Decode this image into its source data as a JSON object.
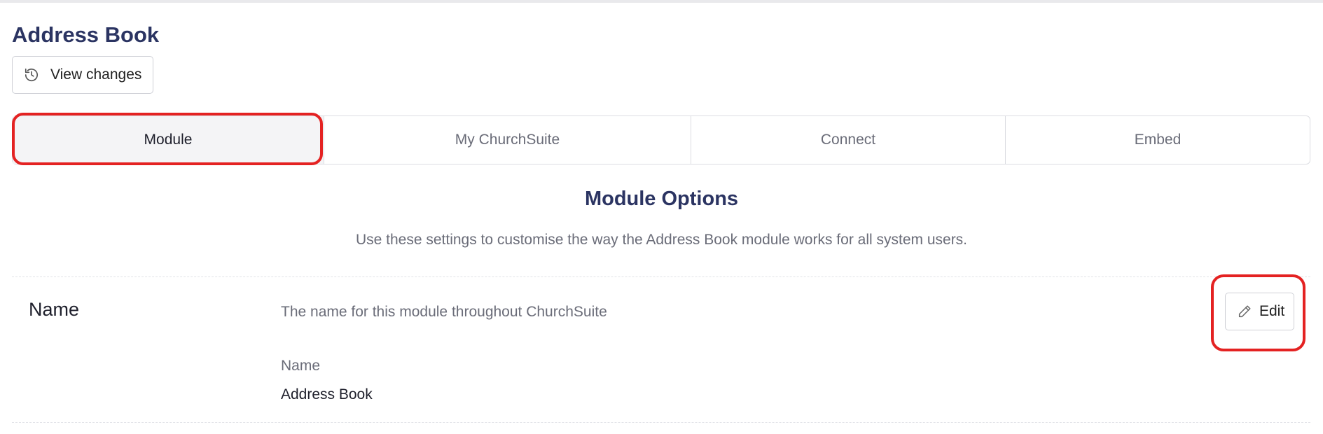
{
  "page": {
    "title": "Address Book"
  },
  "toolbar": {
    "view_changes_label": "View changes",
    "view_changes_icon": "history-icon"
  },
  "tabs": [
    {
      "label": "Module",
      "active": true
    },
    {
      "label": "My ChurchSuite",
      "active": false
    },
    {
      "label": "Connect",
      "active": false
    },
    {
      "label": "Embed",
      "active": false
    }
  ],
  "section": {
    "title": "Module Options",
    "description": "Use these settings to customise the way the Address Book module works for all system users."
  },
  "settings": [
    {
      "name": "Name",
      "description": "The name for this module throughout ChurchSuite",
      "field_label": "Name",
      "field_value": "Address Book",
      "edit_label": "Edit",
      "edit_icon": "pencil-icon"
    }
  ],
  "colors": {
    "title": "#2b3462",
    "annotation": "#e42222",
    "active_tab_bg": "#f4f4f6",
    "muted_text": "#6a6c78"
  }
}
